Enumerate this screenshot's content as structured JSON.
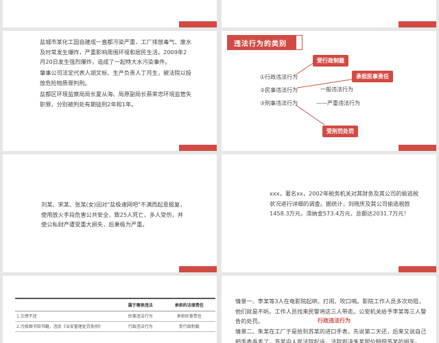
{
  "slide3": {
    "p1": "盐城市某化工园自建成一直都污染严重，工厂排放毒气、废水及时常发生爆炸，严重影响周围环境和居民生活。2009年2月20日发生强烈爆炸，造成了一起特大水污染事件。",
    "p2": "肇事公司法定代表人胡文标、生产负责人丁月生，被法院以投放危险物质罪判刑。",
    "p3": "盐都区环境监察局局长夏从海、局原副局长蔡荣忠环境监管失职罪，分别被判处有期徒刑2年和1年。"
  },
  "slide4": {
    "title": "违法行为的类别",
    "items": [
      "①行政违法行为",
      "②民事违法行为",
      "③刑事违法行为"
    ],
    "tags": {
      "admin": "受行政制裁",
      "civil": "承担民事责任",
      "criminal": "受刑罚处罚"
    },
    "general": "一般违法行为",
    "serious": "——严重违法行为"
  },
  "slide5": {
    "text": "刘某、宋某、张某(女)因对\"盐极速网吧\"不满而起意报复，使用放火手段危害公共安全，致25人死亡，多人受伤，并使公私财产遭受重大损失，后果极为严重。"
  },
  "slide6": {
    "text": "xxx，著名xx，2002年税务机关对其财务及其公司的偷逃税状况进行详细的调查。据统计，刘晓庆及其公司偷逃税款1458.3万元，滞纳金573.4万元，总额达2031.7万元！"
  },
  "slide7": {
    "headers": [
      "",
      "属于哪类违法",
      "承担的法律责任"
    ],
    "rows": [
      [
        "1.欠债不还",
        "民事违法行为",
        "承担民事责任"
      ],
      [
        "2.污损图书馆书籍，违反《治安管理处罚条例》",
        "行政违法行为",
        "受行政制裁"
      ]
    ]
  },
  "slide8": {
    "case1": "情景一、李某等3人在电影院起哄、打闹、吹口哨。影院工作人员多次劝阻，他们就是不听。工作人员找来民警将这三人带走。公安机关给予李某等三人警告的处罚。",
    "tag": "行政违法行为",
    "case2": "情景二、朱某在工厂于是拾到苏某的进口手表，先说第二天还，后来又说自己把手表弄丢了。苏某向人民法院起诉，法院判决朱某照价赔偿苏某的损失。"
  }
}
